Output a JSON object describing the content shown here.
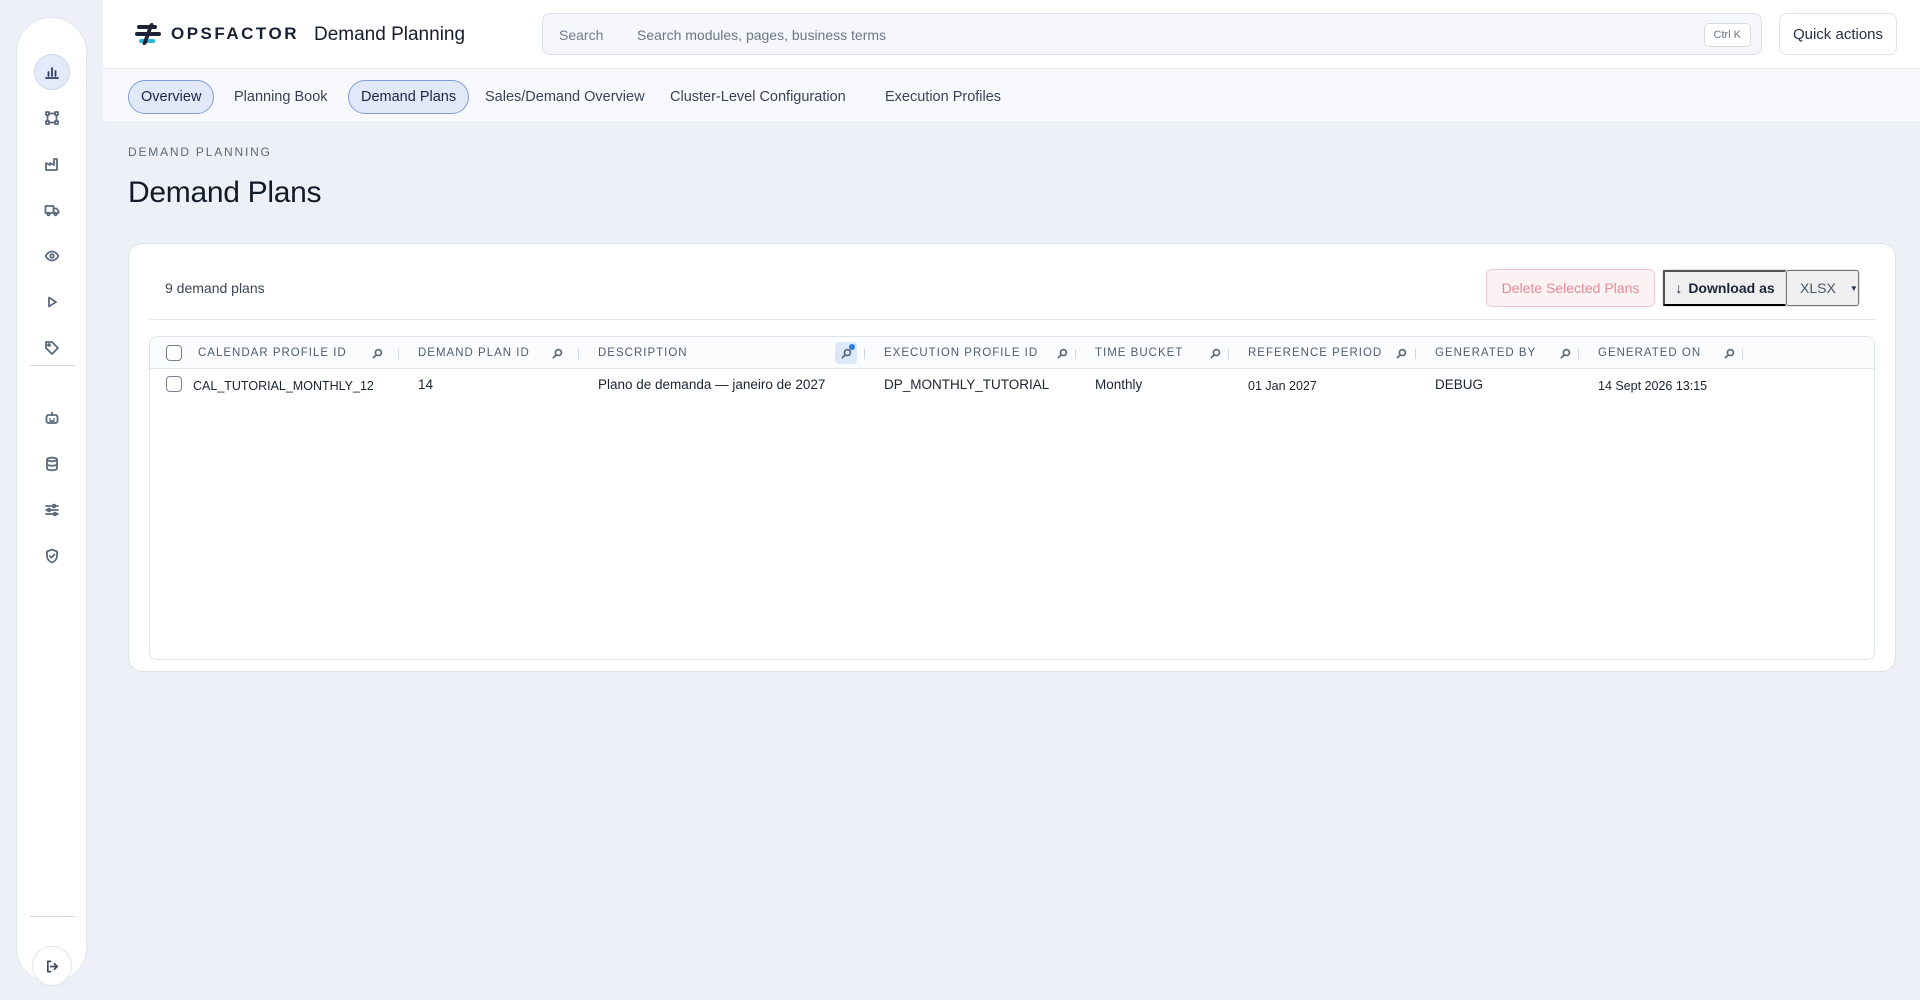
{
  "brand": {
    "name": "OPSFACTOR",
    "module": "Demand Planning"
  },
  "search": {
    "label": "Search",
    "placeholder": "Search modules, pages, business terms",
    "shortcut": "Ctrl K"
  },
  "header": {
    "quick_actions": "Quick actions"
  },
  "rail": {
    "items": [
      {
        "icon": "bar-chart-icon",
        "active": true
      },
      {
        "icon": "network-icon",
        "active": false
      },
      {
        "icon": "factory-icon",
        "active": false
      },
      {
        "icon": "truck-icon",
        "active": false
      },
      {
        "icon": "eye-icon",
        "active": false
      },
      {
        "icon": "play-icon",
        "active": false
      },
      {
        "icon": "tag-icon",
        "active": false
      },
      {
        "icon": "robot-icon",
        "active": false
      },
      {
        "icon": "database-icon",
        "active": false
      },
      {
        "icon": "sliders-icon",
        "active": false
      },
      {
        "icon": "shield-check-icon",
        "active": false
      }
    ],
    "logout_icon": "logout-icon"
  },
  "tabs": [
    {
      "label": "Overview",
      "selected": true
    },
    {
      "label": "Planning Book",
      "selected": false
    },
    {
      "label": "Demand Plans",
      "selected": true
    },
    {
      "label": "Sales/Demand Overview",
      "selected": false
    },
    {
      "label": "Cluster-Level Configuration",
      "selected": false
    },
    {
      "label": "Execution Profiles",
      "selected": false
    }
  ],
  "page": {
    "eyebrow": "DEMAND PLANNING",
    "title": "Demand Plans"
  },
  "card": {
    "count_text": "9 demand plans",
    "delete_label": "Delete Selected Plans",
    "download_label": "Download as",
    "format_value": "XLSX"
  },
  "table": {
    "columns": [
      "CALENDAR PROFILE ID",
      "DEMAND PLAN ID",
      "DESCRIPTION",
      "EXECUTION PROFILE ID",
      "TIME BUCKET",
      "REFERENCE PERIOD",
      "GENERATED BY",
      "GENERATED ON"
    ],
    "rows": [
      [
        "CAL_TUTORIAL_MONTHLY_12",
        "14",
        "Plano de demanda — janeiro de 2027",
        "DP_MONTHLY_TUTORIAL",
        "Monthly",
        "01 Jan 2027",
        "DEBUG",
        "14 Sept 2026 13:15"
      ]
    ]
  },
  "colors": {
    "accent": "#2a7de1",
    "danger_text": "#e58a96",
    "tab_selected_border": "#7f9fd6"
  }
}
